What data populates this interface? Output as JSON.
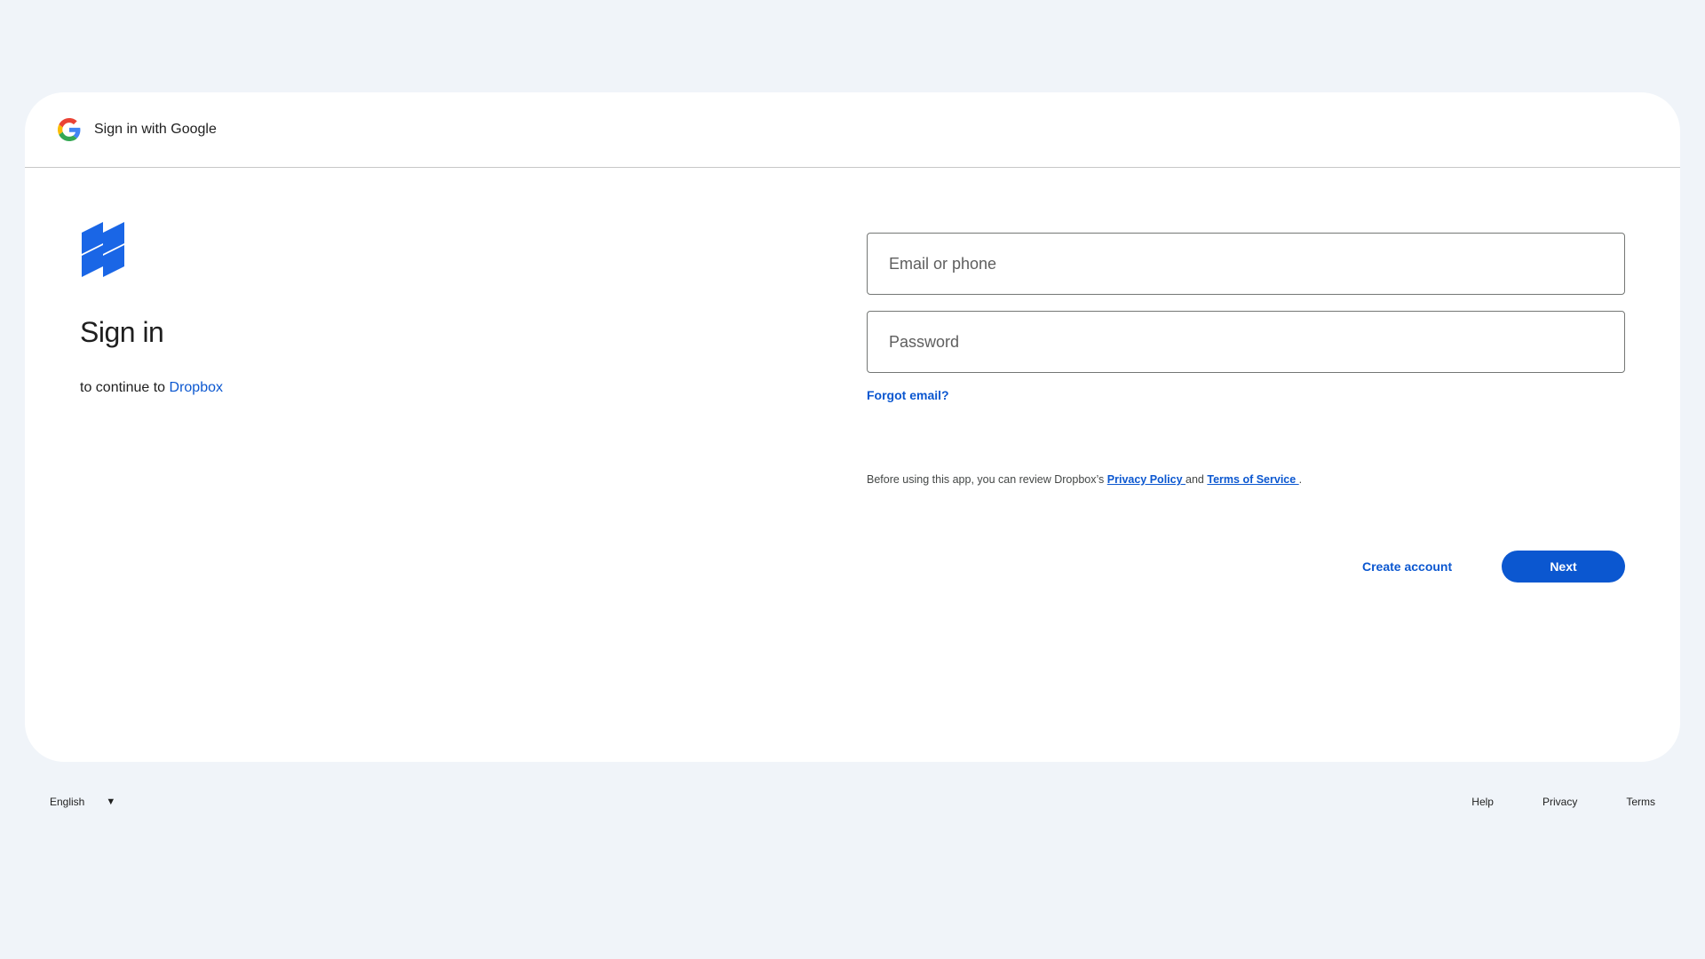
{
  "header": {
    "text": "Sign in with Google"
  },
  "left": {
    "title": "Sign in",
    "subtitle_prefix": "to continue to ",
    "app_name": "Dropbox"
  },
  "form": {
    "email_placeholder": "Email or phone",
    "password_placeholder": "Password",
    "forgot_email": "Forgot email?",
    "legal_prefix": "Before using this app, you can review Dropbox’s ",
    "privacy_policy": "Privacy Policy ",
    "legal_and": "and ",
    "terms_of_service": "Terms of Service ",
    "legal_suffix": "."
  },
  "actions": {
    "create_account": "Create account",
    "next": "Next"
  },
  "footer": {
    "language": "English",
    "language_arrow": "▼",
    "help": "Help",
    "privacy": "Privacy",
    "terms": "Terms"
  },
  "colors": {
    "accent": "#0b57d0",
    "page_bg": "#f0f4f9",
    "brand_blue": "#1a66e6"
  },
  "icons": {
    "header_logo": "google-g-icon",
    "brand_logo": "app-brand-icon"
  }
}
